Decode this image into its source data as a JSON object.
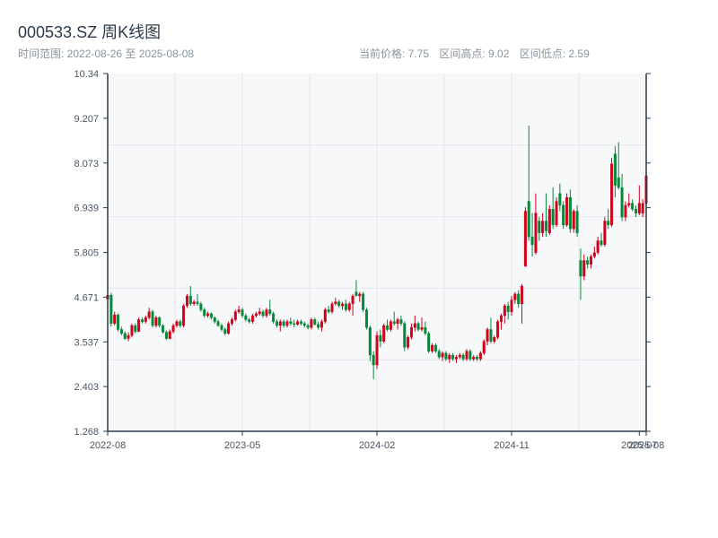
{
  "header": {
    "title": "000533.SZ 周K线图",
    "range_label": "时间范围: 2022-08-26 至 2025-08-08",
    "current_price": "当前价格: 7.75",
    "range_high": "区间高点: 9.02",
    "range_low": "区间低点: 2.59"
  },
  "chart_data": {
    "type": "candlestick",
    "title": "000533.SZ 周K线图",
    "up_color": "#d0021b",
    "down_color": "#06883a",
    "ylim": [
      1.268,
      10.34
    ],
    "y_ticks": [
      "10.34",
      "9.207",
      "8.073",
      "6.939",
      "5.805",
      "4.671",
      "3.537",
      "2.403",
      "1.268"
    ],
    "x_ticks": [
      {
        "label": "2022-08",
        "index": 0
      },
      {
        "label": "2023-05",
        "index": 39
      },
      {
        "label": "2024-02",
        "index": 78
      },
      {
        "label": "2024-11",
        "index": 117
      },
      {
        "label": "2025-07",
        "index": 154
      },
      {
        "label": "2025-08",
        "index": 156
      }
    ],
    "ohlc_fields": [
      "open",
      "high",
      "low",
      "close"
    ],
    "ohlc": [
      [
        4.62,
        4.78,
        4.55,
        4.72
      ],
      [
        4.72,
        4.78,
        3.92,
        4.0
      ],
      [
        4.0,
        4.3,
        3.95,
        4.22
      ],
      [
        4.22,
        4.25,
        3.8,
        3.85
      ],
      [
        3.85,
        3.92,
        3.7,
        3.75
      ],
      [
        3.75,
        3.8,
        3.58,
        3.62
      ],
      [
        3.62,
        3.78,
        3.55,
        3.7
      ],
      [
        3.7,
        4.0,
        3.65,
        3.95
      ],
      [
        3.95,
        4.0,
        3.75,
        3.8
      ],
      [
        3.8,
        4.15,
        3.78,
        4.1
      ],
      [
        4.1,
        4.15,
        4.0,
        4.05
      ],
      [
        4.05,
        4.2,
        4.0,
        4.15
      ],
      [
        4.15,
        4.4,
        4.1,
        4.3
      ],
      [
        4.3,
        4.35,
        3.9,
        3.95
      ],
      [
        3.95,
        4.2,
        3.9,
        4.15
      ],
      [
        4.15,
        4.18,
        3.9,
        3.95
      ],
      [
        3.95,
        3.98,
        3.75,
        3.78
      ],
      [
        3.78,
        3.82,
        3.58,
        3.62
      ],
      [
        3.62,
        3.85,
        3.6,
        3.8
      ],
      [
        3.8,
        4.0,
        3.75,
        3.95
      ],
      [
        3.95,
        4.1,
        3.9,
        4.05
      ],
      [
        4.05,
        4.1,
        3.9,
        3.95
      ],
      [
        3.95,
        4.5,
        3.9,
        4.45
      ],
      [
        4.45,
        4.75,
        4.4,
        4.7
      ],
      [
        4.7,
        4.95,
        4.45,
        4.5
      ],
      [
        4.5,
        4.6,
        4.45,
        4.55
      ],
      [
        4.55,
        4.75,
        4.45,
        4.5
      ],
      [
        4.5,
        4.55,
        4.3,
        4.35
      ],
      [
        4.35,
        4.4,
        4.15,
        4.2
      ],
      [
        4.2,
        4.3,
        4.15,
        4.25
      ],
      [
        4.25,
        4.28,
        4.1,
        4.15
      ],
      [
        4.15,
        4.18,
        4.0,
        4.05
      ],
      [
        4.05,
        4.1,
        3.92,
        3.95
      ],
      [
        3.95,
        4.0,
        3.8,
        3.85
      ],
      [
        3.85,
        3.9,
        3.7,
        3.75
      ],
      [
        3.75,
        4.05,
        3.72,
        4.0
      ],
      [
        4.0,
        4.15,
        3.95,
        4.1
      ],
      [
        4.1,
        4.35,
        4.05,
        4.3
      ],
      [
        4.3,
        4.45,
        4.25,
        4.35
      ],
      [
        4.35,
        4.4,
        4.15,
        4.2
      ],
      [
        4.2,
        4.25,
        4.05,
        4.1
      ],
      [
        4.1,
        4.15,
        4.0,
        4.05
      ],
      [
        4.05,
        4.25,
        4.0,
        4.2
      ],
      [
        4.2,
        4.3,
        4.15,
        4.25
      ],
      [
        4.25,
        4.4,
        4.2,
        4.3
      ],
      [
        4.3,
        4.35,
        4.15,
        4.2
      ],
      [
        4.2,
        4.4,
        4.15,
        4.35
      ],
      [
        4.35,
        4.6,
        4.2,
        4.25
      ],
      [
        4.25,
        4.3,
        4.0,
        4.05
      ],
      [
        4.05,
        4.1,
        3.9,
        3.95
      ],
      [
        3.95,
        4.1,
        3.8,
        4.05
      ],
      [
        4.05,
        4.1,
        3.9,
        3.95
      ],
      [
        3.95,
        4.1,
        3.9,
        4.05
      ],
      [
        4.05,
        4.15,
        3.95,
        4.0
      ],
      [
        4.0,
        4.1,
        3.9,
        3.98
      ],
      [
        3.98,
        4.1,
        3.95,
        4.05
      ],
      [
        4.05,
        4.1,
        3.95,
        4.0
      ],
      [
        4.0,
        4.05,
        3.9,
        3.95
      ],
      [
        3.95,
        4.0,
        3.85,
        3.9
      ],
      [
        3.9,
        4.15,
        3.85,
        4.1
      ],
      [
        4.1,
        4.15,
        3.95,
        3.98
      ],
      [
        3.98,
        4.05,
        3.85,
        3.9
      ],
      [
        3.9,
        4.1,
        3.8,
        4.05
      ],
      [
        4.05,
        4.4,
        4.0,
        4.35
      ],
      [
        4.35,
        4.45,
        4.25,
        4.3
      ],
      [
        4.3,
        4.55,
        4.25,
        4.5
      ],
      [
        4.5,
        4.65,
        4.45,
        4.55
      ],
      [
        4.55,
        4.6,
        4.4,
        4.45
      ],
      [
        4.45,
        4.55,
        4.35,
        4.5
      ],
      [
        4.5,
        4.6,
        4.3,
        4.35
      ],
      [
        4.35,
        4.55,
        4.3,
        4.5
      ],
      [
        4.5,
        4.75,
        4.2,
        4.7
      ],
      [
        4.8,
        5.1,
        4.7,
        4.7
      ],
      [
        4.7,
        4.8,
        4.55,
        4.75
      ],
      [
        4.75,
        4.8,
        4.3,
        4.35
      ],
      [
        4.35,
        4.4,
        3.85,
        3.9
      ],
      [
        3.9,
        3.95,
        3.05,
        3.2
      ],
      [
        3.2,
        3.3,
        2.59,
        2.95
      ],
      [
        2.95,
        3.8,
        2.85,
        3.7
      ],
      [
        3.7,
        3.85,
        3.4,
        3.55
      ],
      [
        3.55,
        4.0,
        3.5,
        3.95
      ],
      [
        3.95,
        4.1,
        3.8,
        3.85
      ],
      [
        3.85,
        4.1,
        3.8,
        4.05
      ],
      [
        4.05,
        4.3,
        3.95,
        4.0
      ],
      [
        4.0,
        4.15,
        3.85,
        4.1
      ],
      [
        4.1,
        4.2,
        3.95,
        4.0
      ],
      [
        4.0,
        4.05,
        3.3,
        3.4
      ],
      [
        3.4,
        3.7,
        3.35,
        3.65
      ],
      [
        3.65,
        4.0,
        3.6,
        3.9
      ],
      [
        3.9,
        4.2,
        3.8,
        4.0
      ],
      [
        4.0,
        4.05,
        3.8,
        3.85
      ],
      [
        3.85,
        4.15,
        3.8,
        3.9
      ],
      [
        3.9,
        4.05,
        3.7,
        3.75
      ],
      [
        3.75,
        3.8,
        3.25,
        3.3
      ],
      [
        3.3,
        3.5,
        3.25,
        3.45
      ],
      [
        3.45,
        3.5,
        3.25,
        3.3
      ],
      [
        3.3,
        3.35,
        3.1,
        3.15
      ],
      [
        3.15,
        3.3,
        3.05,
        3.25
      ],
      [
        3.25,
        3.3,
        3.05,
        3.1
      ],
      [
        3.1,
        3.25,
        3.0,
        3.2
      ],
      [
        3.2,
        3.25,
        3.05,
        3.1
      ],
      [
        3.1,
        3.2,
        3.0,
        3.15
      ],
      [
        3.15,
        3.25,
        3.1,
        3.2
      ],
      [
        3.2,
        3.25,
        3.05,
        3.1
      ],
      [
        3.1,
        3.35,
        3.05,
        3.3
      ],
      [
        3.3,
        3.35,
        3.05,
        3.1
      ],
      [
        3.1,
        3.2,
        3.05,
        3.15
      ],
      [
        3.15,
        3.2,
        3.05,
        3.1
      ],
      [
        3.1,
        3.3,
        3.05,
        3.25
      ],
      [
        3.25,
        3.6,
        3.2,
        3.55
      ],
      [
        3.55,
        3.9,
        3.45,
        3.85
      ],
      [
        3.85,
        4.15,
        3.5,
        3.55
      ],
      [
        3.55,
        3.7,
        3.5,
        3.65
      ],
      [
        3.65,
        4.1,
        3.6,
        4.05
      ],
      [
        4.05,
        4.25,
        3.85,
        4.2
      ],
      [
        4.2,
        4.5,
        4.0,
        4.45
      ],
      [
        4.45,
        4.55,
        4.1,
        4.3
      ],
      [
        4.3,
        4.7,
        4.2,
        4.6
      ],
      [
        4.6,
        4.8,
        4.5,
        4.75
      ],
      [
        4.75,
        4.85,
        4.4,
        4.5
      ],
      [
        4.5,
        5.0,
        4.0,
        4.95
      ],
      [
        5.45,
        6.95,
        5.45,
        6.85
      ],
      [
        7.1,
        9.02,
        6.1,
        6.2
      ],
      [
        6.2,
        6.8,
        5.7,
        6.0
      ],
      [
        5.8,
        7.3,
        5.75,
        6.8
      ],
      [
        6.6,
        6.7,
        6.1,
        6.3
      ],
      [
        6.3,
        6.8,
        6.2,
        6.6
      ],
      [
        6.6,
        7.3,
        6.2,
        6.35
      ],
      [
        6.3,
        7.0,
        6.25,
        6.9
      ],
      [
        6.9,
        7.45,
        6.4,
        6.5
      ],
      [
        6.5,
        7.2,
        6.45,
        7.1
      ],
      [
        7.3,
        7.55,
        6.85,
        7.0
      ],
      [
        7.0,
        7.1,
        6.4,
        6.5
      ],
      [
        6.5,
        7.3,
        6.45,
        7.2
      ],
      [
        7.2,
        7.4,
        6.3,
        6.4
      ],
      [
        6.4,
        6.9,
        6.3,
        6.85
      ],
      [
        6.85,
        7.0,
        6.2,
        6.3
      ],
      [
        5.6,
        5.9,
        4.6,
        5.2
      ],
      [
        5.2,
        5.75,
        5.1,
        5.6
      ],
      [
        5.6,
        5.7,
        5.4,
        5.5
      ],
      [
        5.5,
        5.75,
        5.4,
        5.7
      ],
      [
        5.7,
        5.95,
        5.65,
        5.8
      ],
      [
        5.8,
        6.2,
        5.75,
        6.1
      ],
      [
        6.1,
        6.3,
        5.95,
        6.0
      ],
      [
        6.0,
        6.7,
        5.95,
        6.6
      ],
      [
        6.6,
        6.9,
        6.4,
        6.5
      ],
      [
        6.5,
        8.2,
        6.45,
        8.05
      ],
      [
        8.3,
        8.5,
        7.2,
        7.5
      ],
      [
        7.7,
        8.6,
        7.4,
        7.45
      ],
      [
        7.45,
        7.8,
        6.6,
        6.7
      ],
      [
        6.7,
        7.1,
        6.6,
        7.0
      ],
      [
        7.0,
        7.3,
        6.95,
        7.05
      ],
      [
        7.05,
        7.15,
        6.85,
        6.9
      ],
      [
        6.9,
        7.0,
        6.7,
        6.8
      ],
      [
        6.8,
        7.5,
        6.75,
        7.05
      ],
      [
        6.8,
        7.15,
        6.7,
        7.05
      ],
      [
        7.05,
        7.95,
        7.0,
        7.75
      ]
    ]
  }
}
